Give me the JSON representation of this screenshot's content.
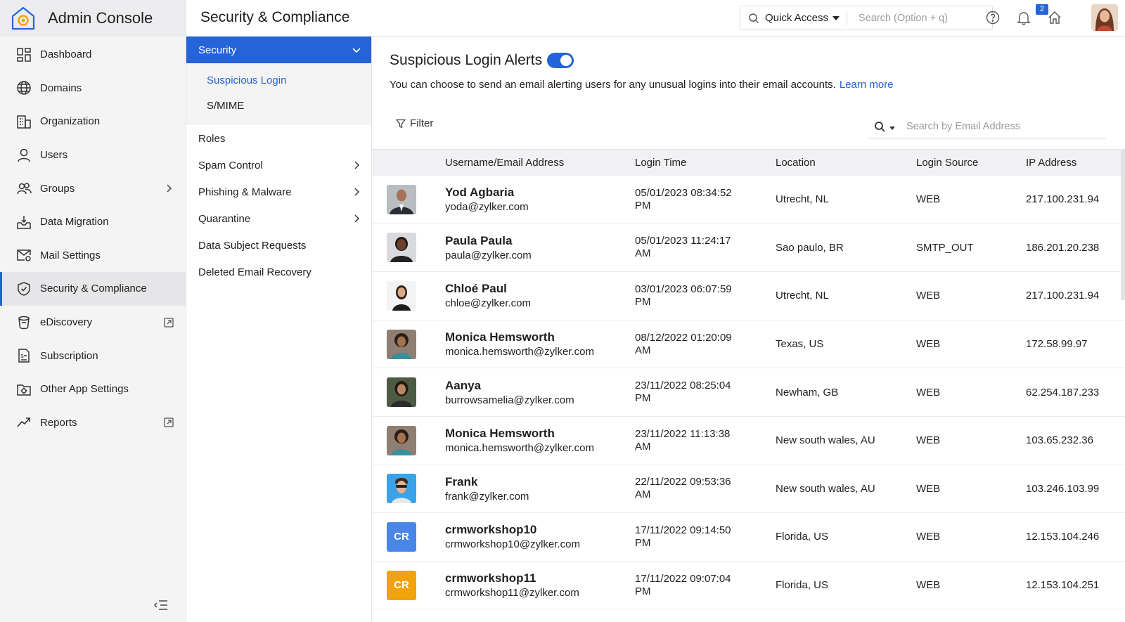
{
  "app": {
    "title": "Admin Console"
  },
  "nav": {
    "items": [
      {
        "label": "Dashboard",
        "icon": "dashboard-icon"
      },
      {
        "label": "Domains",
        "icon": "globe-icon"
      },
      {
        "label": "Organization",
        "icon": "building-icon"
      },
      {
        "label": "Users",
        "icon": "user-icon"
      },
      {
        "label": "Groups",
        "icon": "group-icon"
      },
      {
        "label": "Data Migration",
        "icon": "migration-icon"
      },
      {
        "label": "Mail Settings",
        "icon": "mail-settings-icon"
      },
      {
        "label": "Security & Compliance",
        "icon": "shield-icon"
      },
      {
        "label": "eDiscovery",
        "icon": "ediscovery-icon"
      },
      {
        "label": "Subscription",
        "icon": "subscription-icon"
      },
      {
        "label": "Other App Settings",
        "icon": "app-settings-icon"
      },
      {
        "label": "Reports",
        "icon": "reports-icon"
      }
    ]
  },
  "header": {
    "page_title": "Security & Compliance",
    "quick_access": "Quick Access",
    "search_placeholder": "Search (Option + q)",
    "notification_count": "2"
  },
  "subnav": {
    "section": "Security",
    "children": [
      {
        "label": "Suspicious Login"
      },
      {
        "label": "S/MIME"
      }
    ],
    "items": [
      {
        "label": "Roles"
      },
      {
        "label": "Spam Control"
      },
      {
        "label": "Phishing & Malware"
      },
      {
        "label": "Quarantine"
      },
      {
        "label": "Data Subject Requests"
      },
      {
        "label": "Deleted Email Recovery"
      }
    ]
  },
  "main": {
    "title": "Suspicious Login Alerts",
    "toggle_on": true,
    "description": "You can choose to send an email alerting users for any unusual logins into their email accounts.",
    "learn_more": "Learn more",
    "filter_label": "Filter",
    "email_search_placeholder": "Search by Email Address",
    "columns": [
      "Username/Email Address",
      "Login Time",
      "Location",
      "Login Source",
      "IP Address"
    ],
    "rows": [
      {
        "name": "Yod Agbaria",
        "email": "yoda@zylker.com",
        "time": "05/01/2023 08:34:52 PM",
        "location": "Utrecht, NL",
        "source": "WEB",
        "ip": "217.100.231.94",
        "avatar": ""
      },
      {
        "name": "Paula Paula",
        "email": "paula@zylker.com",
        "time": "05/01/2023 11:24:17 AM",
        "location": "Sao paulo, BR",
        "source": "SMTP_OUT",
        "ip": "186.201.20.238",
        "avatar": ""
      },
      {
        "name": "Chloé Paul",
        "email": "chloe@zylker.com",
        "time": "03/01/2023 06:07:59 PM",
        "location": "Utrecht, NL",
        "source": "WEB",
        "ip": "217.100.231.94",
        "avatar": ""
      },
      {
        "name": "Monica Hemsworth",
        "email": "monica.hemsworth@zylker.com",
        "time": "08/12/2022 01:20:09 AM",
        "location": "Texas, US",
        "source": "WEB",
        "ip": "172.58.99.97",
        "avatar": ""
      },
      {
        "name": "Aanya",
        "email": "burrowsamelia@zylker.com",
        "time": "23/11/2022 08:25:04 PM",
        "location": "Newham, GB",
        "source": "WEB",
        "ip": "62.254.187.233",
        "avatar": ""
      },
      {
        "name": "Monica Hemsworth",
        "email": "monica.hemsworth@zylker.com",
        "time": "23/11/2022 11:13:38 AM",
        "location": "New south wales, AU",
        "source": "WEB",
        "ip": "103.65.232.36",
        "avatar": ""
      },
      {
        "name": "Frank",
        "email": "frank@zylker.com",
        "time": "22/11/2022 09:53:36 AM",
        "location": "New south wales, AU",
        "source": "WEB",
        "ip": "103.246.103.99",
        "avatar": ""
      },
      {
        "name": "crmworkshop10",
        "email": "crmworkshop10@zylker.com",
        "time": "17/11/2022 09:14:50 PM",
        "location": "Florida, US",
        "source": "WEB",
        "ip": "12.153.104.246",
        "avatar": "CR"
      },
      {
        "name": "crmworkshop11",
        "email": "crmworkshop11@zylker.com",
        "time": "17/11/2022 09:07:04 PM",
        "location": "Florida, US",
        "source": "WEB",
        "ip": "12.153.104.251",
        "avatar": "CR"
      }
    ]
  },
  "colors": {
    "accent": "#2463d8",
    "avatar_cr10": "#4a86e8",
    "avatar_cr11": "#f0a30a"
  }
}
